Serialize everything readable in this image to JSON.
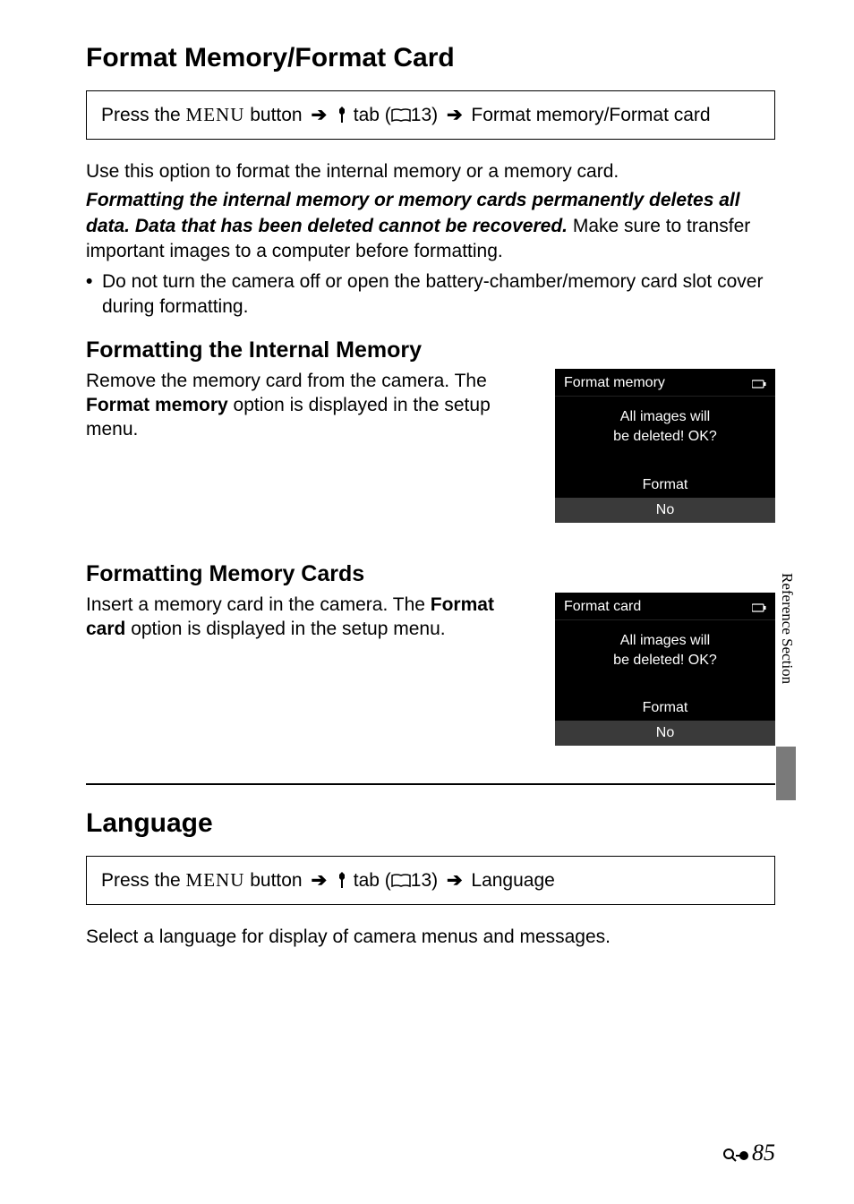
{
  "section1": {
    "title": "Format Memory/Format Card",
    "nav": {
      "pre": "Press the ",
      "menu": "MENU",
      "mid1": " button ",
      "tab": " tab (",
      "ref": "13) ",
      "dest": " Format memory/Format card"
    },
    "intro": "Use this option to format the internal memory or a memory card.",
    "warn": "Formatting the internal memory or memory cards permanently deletes all data. Data that has been deleted cannot be recovered.",
    "post": " Make sure to transfer important images to a computer before formatting.",
    "bullet": "Do not turn the camera off or open the battery-chamber/memory card slot cover during formatting.",
    "sub1": {
      "heading": "Formatting the Internal Memory",
      "text_a": "Remove the memory card from the camera. The ",
      "bold": "Format memory",
      "text_b": " option is displayed in the setup menu.",
      "lcd": {
        "title": "Format memory",
        "line1": "All images will",
        "line2": "be deleted! OK?",
        "opt1": "Format",
        "opt2": "No"
      }
    },
    "sub2": {
      "heading": "Formatting Memory Cards",
      "text_a": "Insert a memory card in the camera. The ",
      "bold": "Format card",
      "text_b": " option is displayed in the setup menu.",
      "lcd": {
        "title": "Format card",
        "line1": "All images will",
        "line2": "be deleted! OK?",
        "opt1": "Format",
        "opt2": "No"
      }
    }
  },
  "section2": {
    "title": "Language",
    "nav": {
      "pre": "Press the ",
      "menu": "MENU",
      "mid1": " button ",
      "tab": " tab (",
      "ref": "13) ",
      "dest": " Language"
    },
    "desc": "Select a language for display of camera menus and messages."
  },
  "side_label": "Reference Section",
  "page_number": "85"
}
